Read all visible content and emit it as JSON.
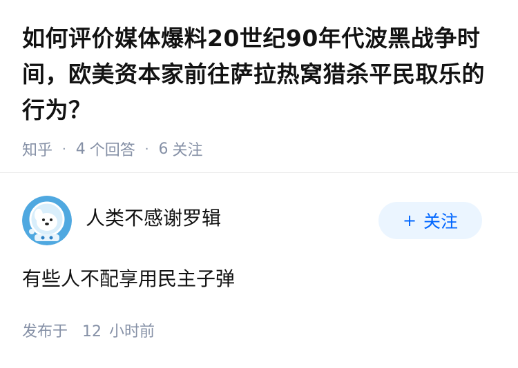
{
  "question": {
    "title": "如何评价媒体爆料20世纪90年代波黑战争时间，欧美资本家前往萨拉热窝猎杀平民取乐的行为？",
    "source": "知乎",
    "answers_count": "4",
    "answers_label": "个回答",
    "followers_count": "6",
    "followers_label": "关注",
    "separator": "·"
  },
  "answer": {
    "author_name": "人类不感谢罗辑",
    "follow_label": "关注",
    "follow_icon": "plus-icon",
    "content": "有些人不配享用民主子弹",
    "time_prefix": "发布于",
    "time_value": "12",
    "time_unit": "小时前"
  },
  "colors": {
    "accent": "#0066ff",
    "follow_bg": "#ebf5ff",
    "meta_text": "#8590a6",
    "title_text": "#121212",
    "avatar_bg": "#4fa8e0"
  }
}
